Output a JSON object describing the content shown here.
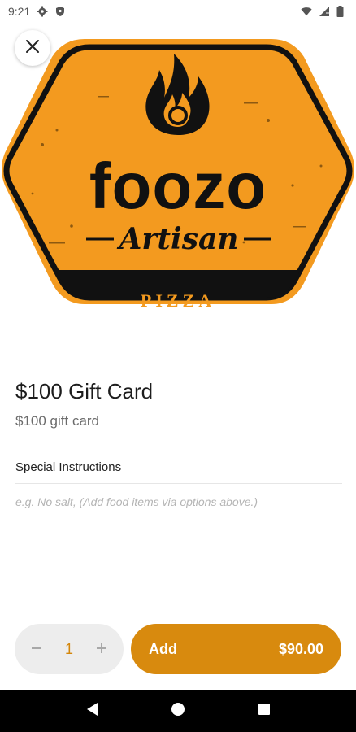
{
  "status_bar": {
    "time": "9:21",
    "left_icons": [
      "gear-icon",
      "shield-icon"
    ],
    "right_icons": [
      "wifi-icon",
      "signal-icon",
      "battery-icon"
    ]
  },
  "hero": {
    "brand_name": "foozo",
    "brand_script": "Artisan",
    "brand_banner": "PIZZA",
    "colors": {
      "badge_orange": "#f39a1f",
      "badge_dark": "#111111"
    }
  },
  "item": {
    "title": "$100 Gift Card",
    "description": "$100 gift card"
  },
  "instructions": {
    "label": "Special Instructions",
    "placeholder": "e.g. No salt, (Add food items via options above.)",
    "value": ""
  },
  "order": {
    "quantity": "1",
    "add_label": "Add",
    "price": "$90.00",
    "accent_color": "#d88a0e"
  },
  "nav": {
    "icons": [
      "back-icon",
      "home-icon",
      "recents-icon"
    ]
  }
}
